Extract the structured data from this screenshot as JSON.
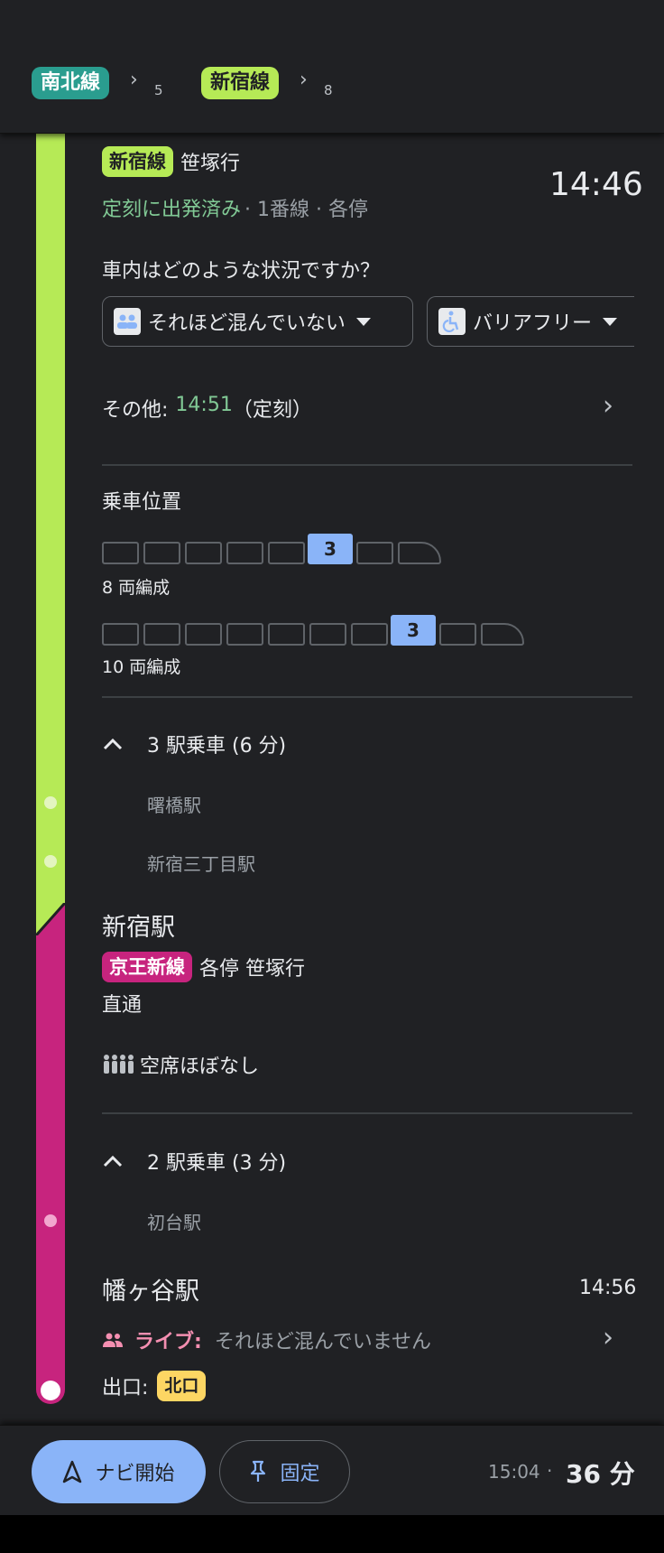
{
  "header": {
    "line1": {
      "label": "南北線",
      "bg": "#2a9d8f",
      "sub": "5"
    },
    "line2": {
      "label": "新宿線",
      "bg": "#b6ea56",
      "sub": "8"
    }
  },
  "segment": {
    "line_badge": "新宿線",
    "destination": "笹塚行",
    "time": "14:46",
    "status": "定刻に出発済み",
    "details": "· 1番線 · 各停",
    "question": "車内はどのような状況ですか？",
    "chip_crowd": "それほど混んでいない",
    "chip_access": "バリアフリー",
    "other_label": "その他:",
    "other_time": "14:51",
    "other_note": "（定刻）"
  },
  "boarding": {
    "title": "乗車位置",
    "formation8_label": "8 両編成",
    "formation8_highlight": "3",
    "formation10_label": "10 両編成",
    "formation10_highlight": "3"
  },
  "stops1": {
    "summary": "3 駅乗車 (6 分)",
    "stations": [
      "曙橋駅",
      "新宿三丁目駅"
    ]
  },
  "transfer": {
    "station": "新宿駅",
    "line_badge": "京王新線",
    "service": "各停 笹塚行",
    "through": "直通",
    "crowd": "空席ほぼなし"
  },
  "stops2": {
    "summary": "2 駅乗車 (3 分)",
    "stations": [
      "初台駅"
    ]
  },
  "arrival": {
    "station": "幡ヶ谷駅",
    "time": "14:56",
    "live_label": "ライブ:",
    "live_text": "それほど混んでいません",
    "exit_label": "出口:",
    "exit_name": "北口"
  },
  "bottom": {
    "nav_label": "ナビ開始",
    "pin_label": "固定",
    "arrival_time": "15:04",
    "sep": "·",
    "duration": "36 分"
  },
  "colors": {
    "green_line": "#b6ea56",
    "pink_line": "#c7247e",
    "teal_line": "#2a9d8f",
    "accent_blue": "#8ab4f8",
    "status_green": "#81c995",
    "exit_yellow": "#fdd663"
  },
  "icons": [
    "chevron-right-icon",
    "crowd-icon",
    "wheelchair-icon",
    "chevron-down-icon",
    "chevron-up-icon",
    "people-icon",
    "navigation-icon",
    "pin-icon"
  ]
}
